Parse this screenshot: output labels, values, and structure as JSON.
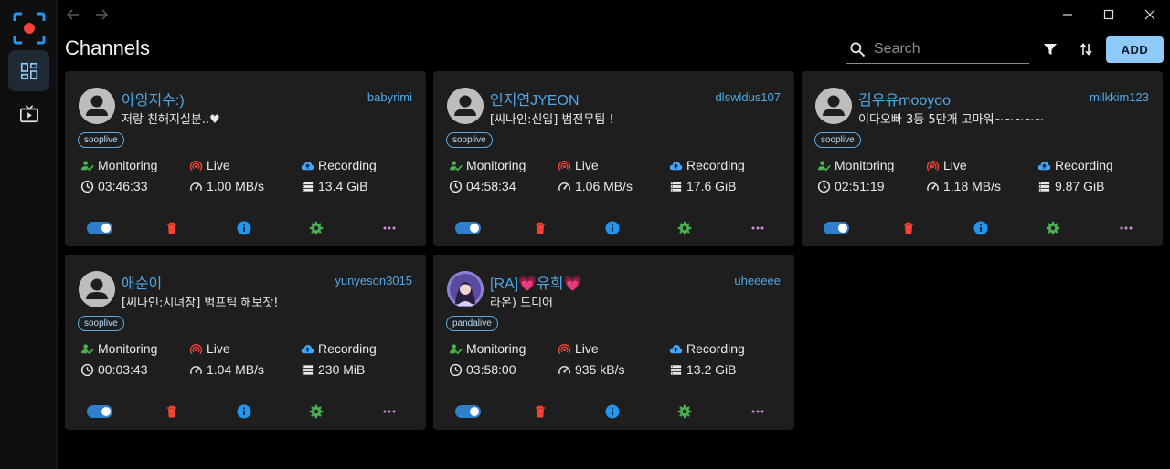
{
  "app": {
    "title": "Channels",
    "logo_icon": "record-target-icon",
    "nav": [
      {
        "icon": "dashboard-icon",
        "active": true
      },
      {
        "icon": "live-tv-icon",
        "active": false
      }
    ]
  },
  "toolbar": {
    "search_placeholder": "Search",
    "add_label": "ADD",
    "filter_icon": "filter-icon",
    "sort_icon": "sort-icon"
  },
  "colors": {
    "accent": "#4fa8e8",
    "monitoring": "#4caf50",
    "live": "#f44336",
    "recording": "#42a5f5",
    "delete": "#f44336",
    "info": "#2196f3",
    "settings": "#4caf50",
    "more": "#ce93d8",
    "add_button": "#90caf9"
  },
  "labels": {
    "monitoring": "Monitoring",
    "live": "Live",
    "recording": "Recording"
  },
  "channels": [
    {
      "name": "아잉지수:)",
      "username": "babyrimi",
      "title": "저랑 친해지실분..♥",
      "platform": "sooplive",
      "duration": "03:46:33",
      "speed": "1.00 MB/s",
      "size": "13.4 GiB",
      "enabled": true
    },
    {
      "name": "인지연JYEON",
      "username": "dlswldus107",
      "title": "[씨나인:신입] 범전무팀 !",
      "platform": "sooplive",
      "duration": "04:58:34",
      "speed": "1.06 MB/s",
      "size": "17.6 GiB",
      "enabled": true
    },
    {
      "name": "김우유mooyoo",
      "username": "milkkim123",
      "title": "이다오빠 3등 5만개 고마워~~~~~",
      "platform": "sooplive",
      "duration": "02:51:19",
      "speed": "1.18 MB/s",
      "size": "9.87 GiB",
      "enabled": true
    },
    {
      "name": "애순이",
      "username": "yunyeson3015",
      "title": "[씨나인:시녀장] 범프팀 해보잣!",
      "platform": "sooplive",
      "duration": "00:03:43",
      "speed": "1.04 MB/s",
      "size": "230 MiB",
      "enabled": true
    },
    {
      "name": "[RA]💗유희💗",
      "username": "uheeeee",
      "title": "라온) 드디어",
      "platform": "pandalive",
      "duration": "03:58:00",
      "speed": "935 kB/s",
      "size": "13.2 GiB",
      "enabled": true
    }
  ]
}
